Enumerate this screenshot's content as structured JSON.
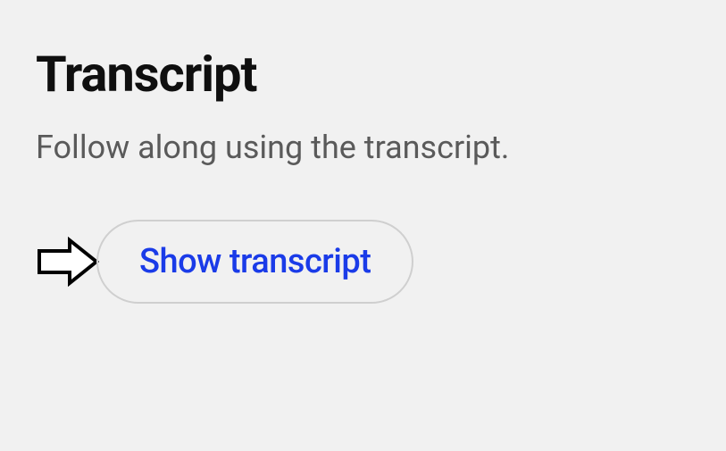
{
  "transcript": {
    "title": "Transcript",
    "subtitle": "Follow along using the transcript.",
    "button_label": "Show transcript"
  }
}
